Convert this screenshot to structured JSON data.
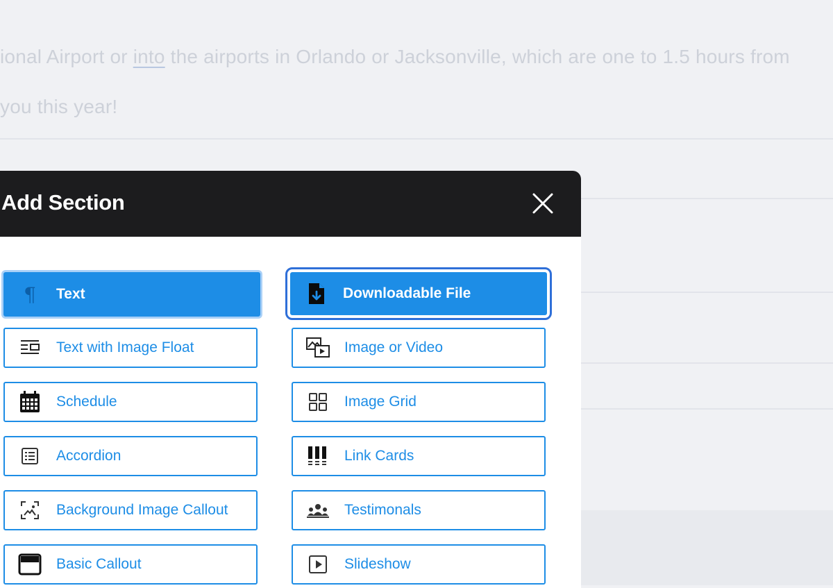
{
  "background": {
    "line1_before": "ional Airport or ",
    "line1_link": "into",
    "line1_after": " the airports in Orlando or Jacksonville, which are one to 1.5 hours from",
    "line2": "you this year!"
  },
  "modal": {
    "title": "Add Section",
    "close_icon": "close-icon"
  },
  "options": [
    {
      "label": "Text",
      "icon": "pilcrow-icon",
      "state": "selected"
    },
    {
      "label": "Downloadable File",
      "icon": "file-download-icon",
      "state": "focused"
    },
    {
      "label": "Text with Image Float",
      "icon": "text-image-float-icon"
    },
    {
      "label": "Image or Video",
      "icon": "image-video-icon"
    },
    {
      "label": "Schedule",
      "icon": "calendar-icon"
    },
    {
      "label": "Image Grid",
      "icon": "grid-icon"
    },
    {
      "label": "Accordion",
      "icon": "accordion-icon"
    },
    {
      "label": "Link Cards",
      "icon": "link-cards-icon"
    },
    {
      "label": "Background Image Callout",
      "icon": "background-image-icon"
    },
    {
      "label": "Testimonals",
      "icon": "people-icon"
    },
    {
      "label": "Basic Callout",
      "icon": "callout-icon"
    },
    {
      "label": "Slideshow",
      "icon": "slideshow-icon"
    }
  ],
  "colors": {
    "accent": "#1d8de6",
    "header_bg": "#1c1c1e",
    "focus_ring": "#2f6fd8"
  }
}
